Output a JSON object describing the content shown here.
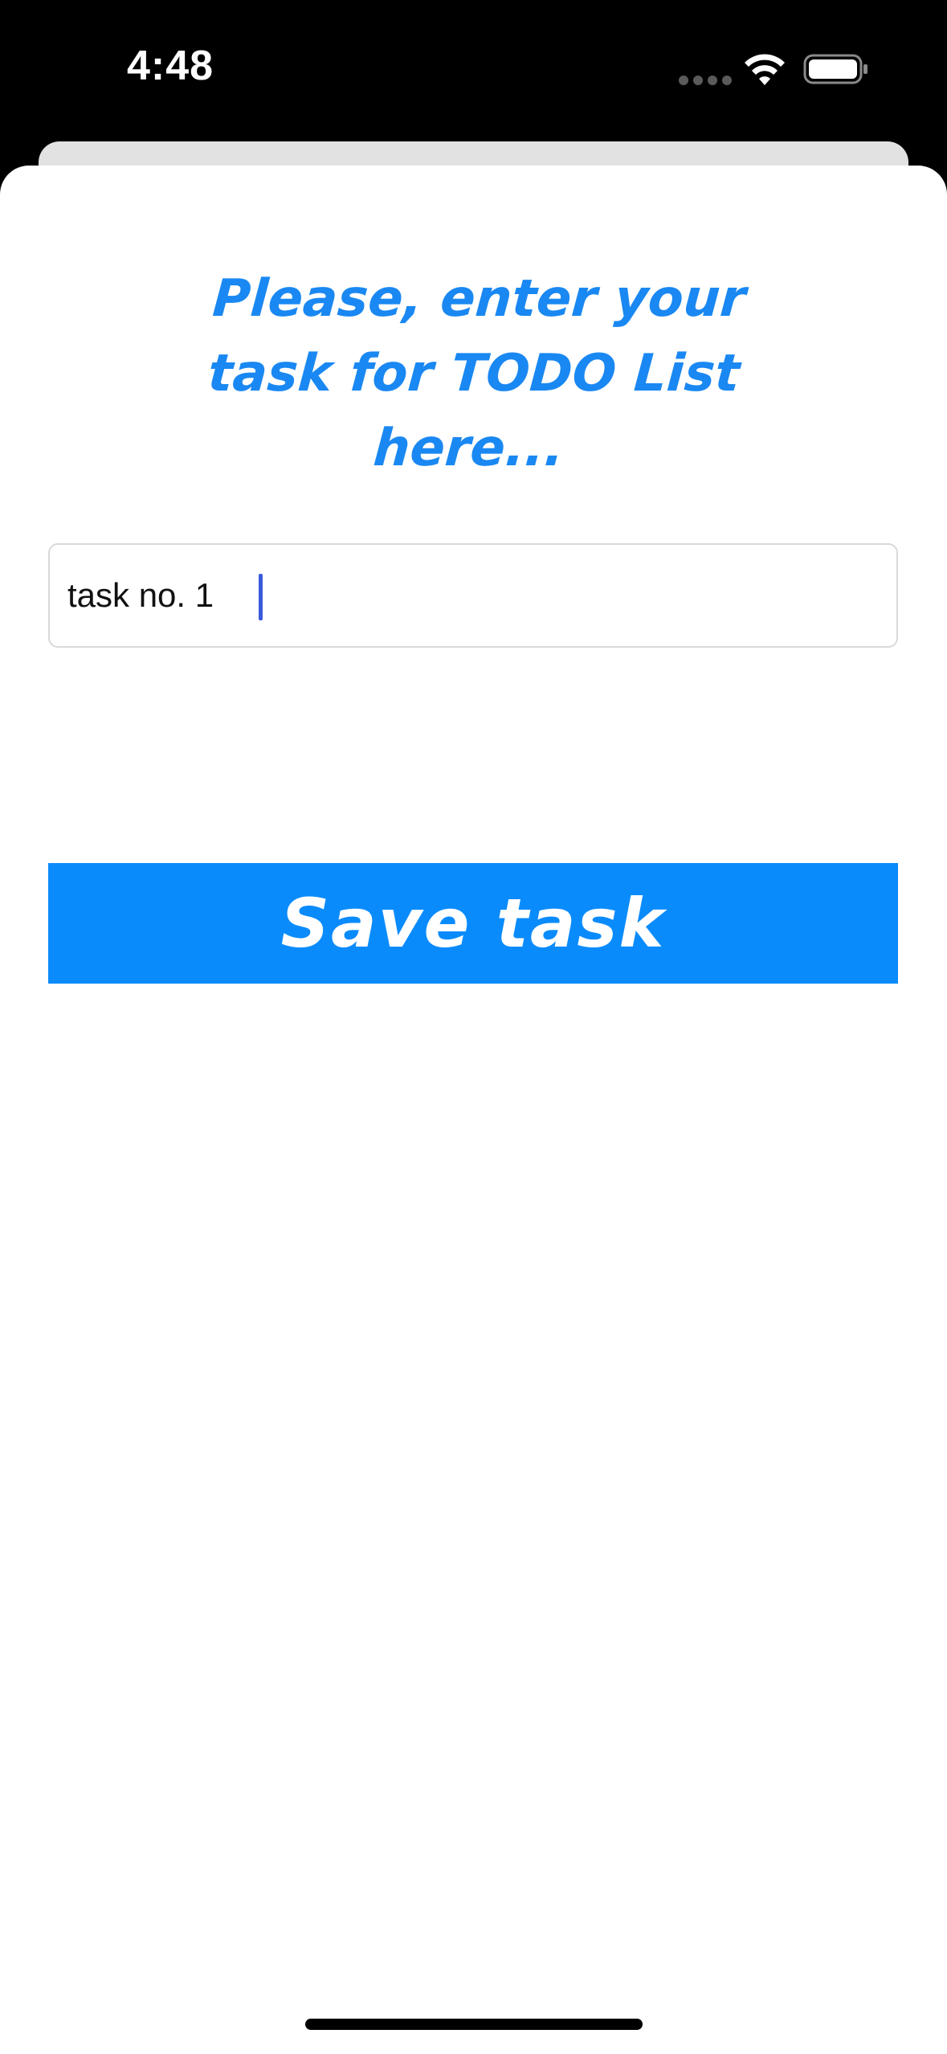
{
  "status_bar": {
    "time": "4:48",
    "icons": [
      "cellular-signal-icon",
      "wifi-icon",
      "battery-icon"
    ]
  },
  "sheet": {
    "title": "Please, enter your task for TODO List here...",
    "title_color": "#1a88f2",
    "task_input": {
      "value": "task no. 1",
      "placeholder": ""
    },
    "save_button": {
      "label": "Save task",
      "background": "#0a8bfc"
    }
  }
}
